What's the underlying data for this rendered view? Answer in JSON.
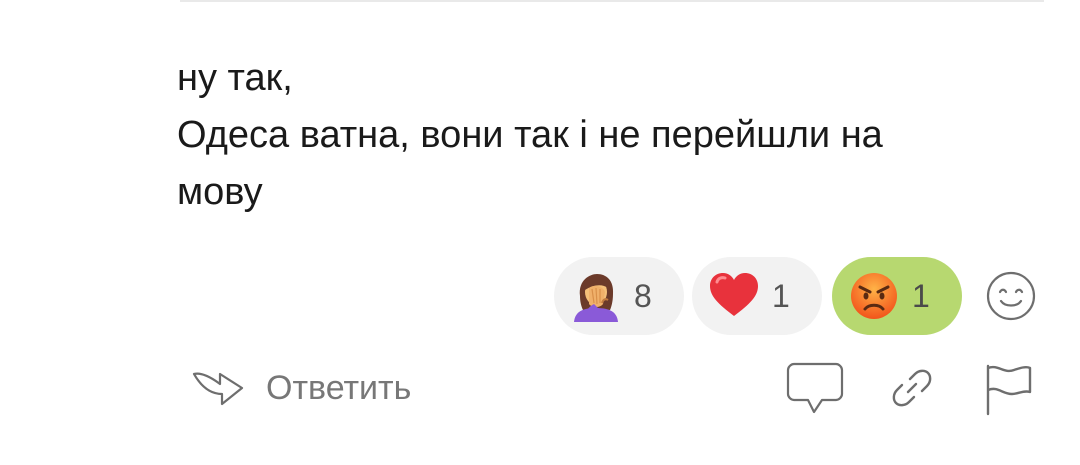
{
  "comment": {
    "lines": [
      "ну так,",
      "Одеса ватна, вони так і не перейшли на",
      "мову"
    ]
  },
  "reactions": [
    {
      "icon": "woman-facepalming-icon",
      "count": "8",
      "active": false
    },
    {
      "icon": "red-heart-icon",
      "count": "1",
      "active": false
    },
    {
      "icon": "angry-face-icon",
      "count": "1",
      "active": true
    }
  ],
  "add_reaction": {
    "icon": "smiley-add-reaction-icon"
  },
  "actions": {
    "reply_label": "Ответить",
    "reply_icon": "reply-arrow-icon",
    "comment_icon": "speech-bubble-icon",
    "link_icon": "link-icon",
    "flag_icon": "flag-icon"
  },
  "colors": {
    "active_reaction_bg": "#b7d870",
    "reaction_bg": "#f2f2f2",
    "text": "#1a1a1a",
    "muted": "#777777"
  }
}
